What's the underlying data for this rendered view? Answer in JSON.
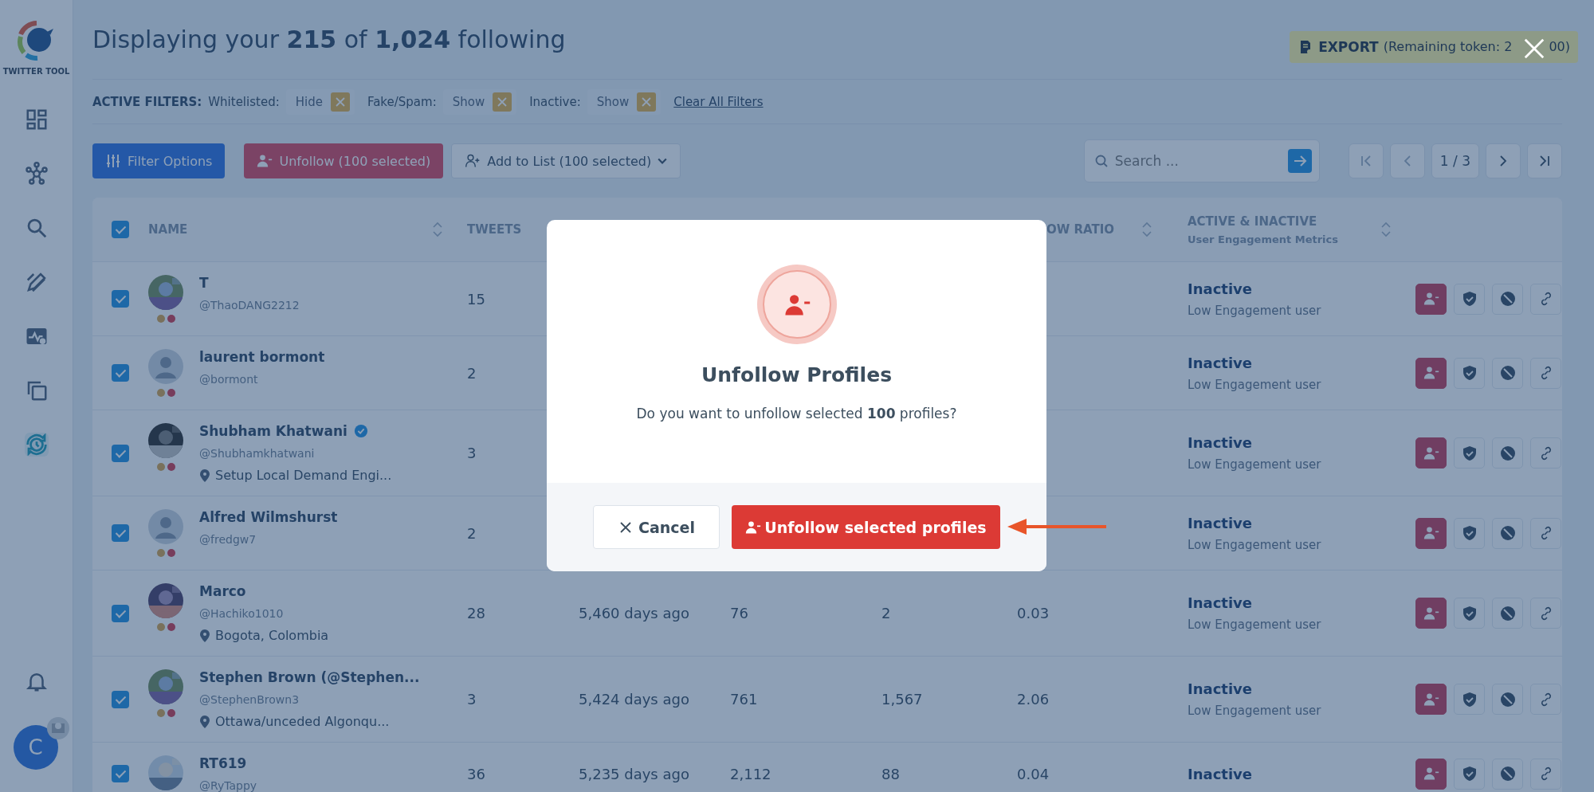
{
  "sidebar": {
    "logo_text": "TWITTER TOOL",
    "items": [
      {
        "kind": "dashboard",
        "selected": false
      },
      {
        "kind": "network",
        "selected": false
      },
      {
        "kind": "search",
        "selected": false
      },
      {
        "kind": "edit",
        "selected": false
      },
      {
        "kind": "activity",
        "selected": false
      },
      {
        "kind": "copy",
        "selected": false
      },
      {
        "kind": "history",
        "selected": true
      }
    ],
    "avatar_letter": "C"
  },
  "header": {
    "title": "Displaying your **215** of **1,024** following",
    "export_label": "EXPORT",
    "export_note_start": "(Remaining token: 2",
    "export_note_end": "00)"
  },
  "filters": {
    "label": "ACTIVE FILTERS:",
    "items": [
      {
        "name": "Whitelisted:",
        "value": "Hide"
      },
      {
        "name": "Fake/Spam:",
        "value": "Show"
      },
      {
        "name": "Inactive:",
        "value": "Show"
      }
    ],
    "clear": "Clear All Filters"
  },
  "toolbar": {
    "filter_button": "Filter Options",
    "unfollow_button": "Unfollow (100 selected)",
    "list_button": "Add to List (100 selected)",
    "search_placeholder": "Search ...",
    "page": "1 / 3"
  },
  "table": {
    "all_checked": true,
    "columns": [
      {
        "kind": "name",
        "label": "NAME",
        "sortable": true
      },
      {
        "kind": "tweets",
        "label": "TWEETS",
        "sortable": false
      },
      {
        "kind": "column_6",
        "label": "OW RATIO",
        "sortable": true
      },
      {
        "kind": "activity",
        "label": "ACTIVE & INACTIVE",
        "sublabel": "User Engagement Metrics",
        "sortable": true
      }
    ],
    "rows": [
      {
        "checked": true,
        "name": "T",
        "verified": false,
        "handle": "@ThaoDANG2212",
        "tweets": "15",
        "status": "Inactive",
        "status_note": "Low Engagement user"
      },
      {
        "kind": "default",
        "checked": true,
        "name": "laurent bormont",
        "verified": false,
        "handle": "@bormont",
        "tweets": "2",
        "status": "Inactive",
        "status_note": "Low Engagement user"
      },
      {
        "checked": true,
        "name": "Shubham Khatwani",
        "verified": true,
        "handle": "@Shubhamkhatwani",
        "location": "Setup Local Demand Engi...",
        "tweets": "3",
        "status": "Inactive",
        "status_note": "Low Engagement user"
      },
      {
        "kind": "default",
        "checked": true,
        "name": "Alfred Wilmshurst",
        "verified": false,
        "handle": "@fredgw7",
        "tweets": "2",
        "status": "Inactive",
        "status_note": "Low Engagement user"
      },
      {
        "checked": true,
        "name": "Marco",
        "verified": false,
        "handle": "@Hachiko1010",
        "location": "Bogota, Colombia",
        "tweets": "28",
        "column_3": "5,460 days ago",
        "column_4": "76",
        "column_5": "2",
        "column_6": "0.03",
        "status": "Inactive",
        "status_note": "Low Engagement user"
      },
      {
        "checked": true,
        "name": "Stephen Brown (@Stephen...",
        "verified": false,
        "handle": "@StephenBrown3",
        "location": "Ottawa/unceded Algonqu...",
        "tweets": "3",
        "column_3": "5,424 days ago",
        "column_4": "761",
        "column_5": "1,567",
        "column_6": "2.06",
        "status": "Inactive",
        "status_note": "Low Engagement user"
      },
      {
        "checked": true,
        "name": "RT619",
        "verified": false,
        "handle": "@RyTappy",
        "tweets": "36",
        "column_3": "5,235 days ago",
        "column_4": "2,112",
        "column_5": "88",
        "column_6": "0.04",
        "status": "Inactive"
      }
    ]
  },
  "modal": {
    "title": "Unfollow Profiles",
    "message": "Do you want to unfollow selected **100** profiles?",
    "cancel": "Cancel",
    "confirm": "Unfollow selected profiles"
  }
}
